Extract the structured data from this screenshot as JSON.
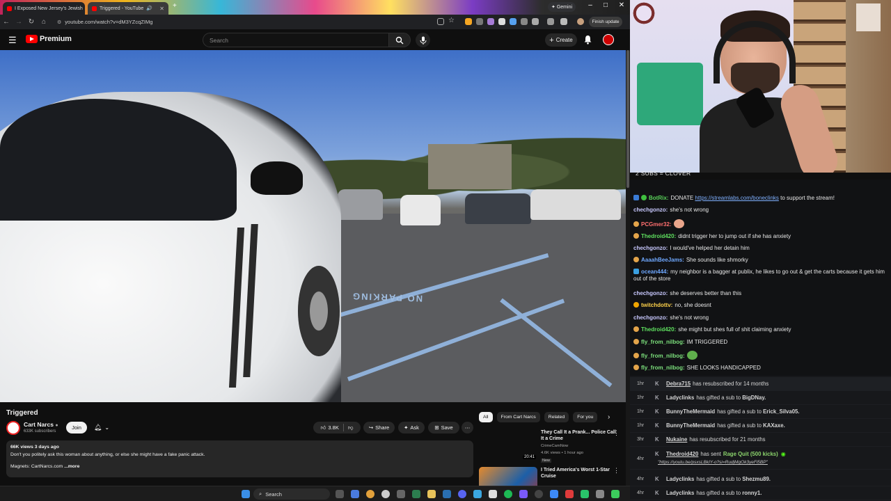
{
  "browser": {
    "tabs": [
      {
        "label": "I Exposed New Jersey's Jewish"
      },
      {
        "label": "Triggered - YouTube"
      }
    ],
    "gemini_label": "Gemini",
    "url": "youtube.com/watch?v=dM3YZcqZIMg",
    "finish_update_label": "Finish update"
  },
  "youtube": {
    "logo_text": "Premium",
    "search_placeholder": "Search",
    "create_label": "Create",
    "video_title": "Triggered",
    "channel_name": "Cart Narcs",
    "channel_subs": "633K subscribers",
    "join_label": "Join",
    "like_count": "3.8K",
    "share_label": "Share",
    "ask_label": "Ask",
    "save_label": "Save",
    "desc_meta": "66K views  3 days ago",
    "desc_text": "Don't you politely ask this woman about anything, or else she might have a fake panic attack.",
    "desc_links": "Magnets: CartNarcs.com",
    "desc_more": "...more",
    "video_overlay_text": "NO PARKING",
    "chips": [
      "All",
      "From Cart Narcs",
      "Related",
      "For you"
    ],
    "recs": [
      {
        "title": "They Call It a Prank... Police Call It a Crime",
        "channel": "CrimeCamNow",
        "meta": "4.6K views • 1 hour ago",
        "badge": "New",
        "duration": "20:41"
      },
      {
        "title": "I Tried America's Worst 1-Star Cruise",
        "channel": "",
        "meta": "",
        "badge": "",
        "duration": ""
      }
    ]
  },
  "taskbar": {
    "search_label": "Search"
  },
  "stream": {
    "caption": "2 SUBS = CLOVER",
    "chat": [
      {
        "user": "BotRix:",
        "color": "#5ad35a",
        "text": "DONATE ",
        "link": "https://streamlabs.com/boneclinks",
        "tail": " to support the stream!"
      },
      {
        "user": "chechgonzo:",
        "color": "#c9c9ff",
        "text": "she's not wrong"
      },
      {
        "user": "PCGmer32:",
        "color": "#ff6f6f",
        "text": ""
      },
      {
        "user": "Thedroid420:",
        "color": "#5fe05f",
        "text": "didnt trigger her to jump out if she has anxiety"
      },
      {
        "user": "chechgonzo:",
        "color": "#c9c9ff",
        "text": "I would've helped her detain him"
      },
      {
        "user": "AaaahBeeJams:",
        "color": "#6fa8ff",
        "text": "She sounds like shmorky"
      },
      {
        "user": "ocean444:",
        "color": "#6fa8ff",
        "text": "my neighbor is a bagger at publix, he likes to go out & get the carts because it gets him out of the store"
      },
      {
        "user": "chechgonzo:",
        "color": "#c9c9ff",
        "text": "she deserves better than this"
      },
      {
        "user": "twitchdottv:",
        "color": "#ffd24a",
        "text": "no, she doesnt"
      },
      {
        "user": "chechgonzo:",
        "color": "#c9c9ff",
        "text": "she's not wrong"
      },
      {
        "user": "Thedroid420:",
        "color": "#5fe05f",
        "text": "she might but shes full of shit claiming anxiety"
      },
      {
        "user": "fly_from_nilbog:",
        "color": "#7ce07c",
        "text": "IM TRIGGERED"
      },
      {
        "user": "fly_from_nilbog:",
        "color": "#7ce07c",
        "text": ""
      },
      {
        "user": "fly_from_nilbog:",
        "color": "#7ce07c",
        "text": "SHE LOOKS HANDICAPPED"
      }
    ],
    "events": [
      {
        "time": "1hr",
        "name": "Debra715",
        "text": "has resubscribed for 14 months"
      },
      {
        "time": "1hr",
        "name": "Ladyclinks",
        "text": "has gifted a sub to",
        "target": "BigDNay."
      },
      {
        "time": "1hr",
        "name": "BunnyTheMermaid",
        "text": "has gifted a sub to",
        "target": "Erick_Silva05."
      },
      {
        "time": "1hr",
        "name": "BunnyTheMermaid",
        "text": "has gifted a sub to",
        "target": "KAXaxe."
      },
      {
        "time": "3hr",
        "name": "Nukaine",
        "text": "has resubscribed for 21 months"
      },
      {
        "time": "4hr",
        "name": "Thedroid420",
        "text": "has sent",
        "reward": "Rage Quit (500 kicks)",
        "link": "\"https://youtu.be/psxsLBkIY-o?si=RudjMgOk3yeFl5BP\""
      },
      {
        "time": "4hr",
        "name": "Ladyclinks",
        "text": "has gifted a sub to",
        "target": "Shezmu89."
      },
      {
        "time": "4hr",
        "name": "Ladyclinks",
        "text": "has gifted a sub to",
        "target": "ronny1."
      }
    ]
  }
}
